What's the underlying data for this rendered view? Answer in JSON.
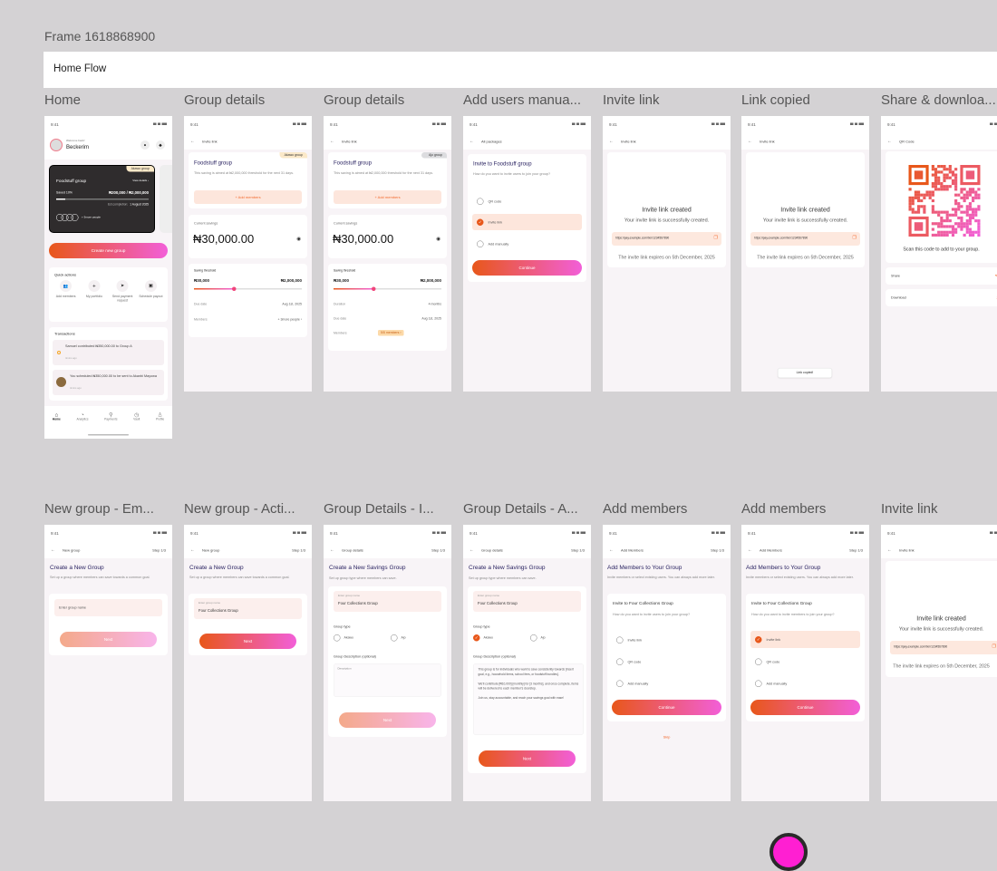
{
  "canvas": {
    "frame_label": "Frame 1618868900",
    "section_title": "Home Flow"
  },
  "frame_titles": [
    "Home",
    "Group details",
    "Group details",
    "Add users manua...",
    "Invite link",
    "Link copied",
    "Share & downloa...",
    "New group - Em...",
    "New group - Acti...",
    "Group Details - I...",
    "Group Details - A...",
    "Add members",
    "Add members",
    "Invite link"
  ],
  "status_time": "9:41",
  "colors": {
    "accent_start": "#e8571a",
    "accent_end": "#f25fd8",
    "title": "#2b2462",
    "canvas": "#d4d2d4",
    "collaborator_cursor": "#ff1fd2"
  },
  "home": {
    "welcome": "Welcome back!",
    "user": "Beckerim",
    "card": {
      "tag": "Akawo group",
      "name": "Foodstuff group",
      "view": "View details ›",
      "saved": "Saved 10%",
      "amount": "₦200,000 / ₦2,000,000",
      "progress_percent": 10,
      "est_label": "Est.completion:",
      "est_date": "1 August 2025",
      "more": "+ 5more people"
    },
    "create": "Create new group",
    "quick_title": "Quick actions",
    "quick": [
      {
        "label": "Add members",
        "icon": "users-icon"
      },
      {
        "label": "My portfolio",
        "icon": "plus-icon"
      },
      {
        "label": "Send payment request",
        "icon": "send-icon"
      },
      {
        "label": "Schedule payout",
        "icon": "calendar-money-icon"
      }
    ],
    "tx_title": "Transactions",
    "tx": [
      {
        "text": "Samuel contributed ₦350,000.00 to Group A",
        "time": "4mins ago"
      },
      {
        "text": "You scheduled ₦350,000.00 to be sent to Akanbi Mayowa",
        "time": "4mins ago"
      }
    ],
    "nav": [
      "Home",
      "Analytics",
      "Payments",
      "Vault",
      "Profile"
    ]
  },
  "group_details": {
    "header": "Invite link",
    "tag_akawo": "Akawo group",
    "tag_ajo": "Ajo group",
    "name": "Foodstuff group",
    "desc": "This saving is aimed at ₦2,000,000 threshold for the next 31 days.",
    "add": "+  Add members",
    "savings_label": "Current savings",
    "savings": "₦30,000.00",
    "threshold_label": "Saving threshold",
    "min": "₦30,000",
    "max": "₦2,000,000",
    "progress_percent": 37,
    "duration_label": "Duration",
    "duration": "4 months",
    "due_label": "Due date",
    "due": "Aug 1st, 2025",
    "members_label": "Members",
    "members_more": "+ 3more people ›",
    "members_count": "5/5 members ›"
  },
  "invite_choice": {
    "header": "All packages",
    "title": "Invite to Foodstuff group",
    "sub": "How do you want to invite users to join your group?",
    "options": [
      "QR code",
      "Invite link",
      "Add manually"
    ],
    "continue": "Continue"
  },
  "invite_link": {
    "header": "Invite link",
    "title": "Invite link created",
    "sub": "Your invite link is successfully created.",
    "url": "https://pay.example.com/txn/1234567890",
    "expires": "The invite link expires on 5th December, 2025",
    "toast": "Link copied!"
  },
  "qr": {
    "header": "QR Code",
    "caption": "Scan this code to add to your group.",
    "share": "Share",
    "download": "Download"
  },
  "new_group": {
    "header": "New group",
    "step": "Step 1/3",
    "title": "Create a New Group",
    "sub": "Set up a group where members can save towards a common goal.",
    "placeholder": "Enter group name",
    "label": "Enter group name",
    "value": "Four Collections Group",
    "next": "Next"
  },
  "group_setup": {
    "header": "Group details",
    "step": "Step 1/3",
    "title": "Create a New Savings Group",
    "sub": "Set up group type where members can save.",
    "name_label": "Enter group name",
    "name_value": "Four Collections Group",
    "type_label": "Group type",
    "types": [
      "Akawo",
      "Ajo"
    ],
    "desc_label": "Group Description (optional)",
    "desc_placeholder": "Description",
    "desc_value": "This group is for individuals who want to save consistently towards [insert goal, e.g., household items, school fees, or foodstuff bundles].\n\nWe'll contribute [₦10,000] [monthly] for [3 months], and once complete, items will be delivered to each member's doorstep.\n\nJoin us, stay accountable, and reach your savings goal with ease!",
    "next": "Next"
  },
  "add_members": {
    "header": "Add Members",
    "step": "Step 1/3",
    "title": "Add Members to Your Group",
    "sub": "Invite members or select existing users. You can always add more later.",
    "card_title": "Invite to Four Collections Group",
    "card_sub_users": "How do you want to invite users to join your group?",
    "card_sub_members": "How do you want to invite members to join your group?",
    "options": [
      "Invite link",
      "QR code",
      "Add manually"
    ],
    "continue": "Continue",
    "skip": "Skip"
  }
}
